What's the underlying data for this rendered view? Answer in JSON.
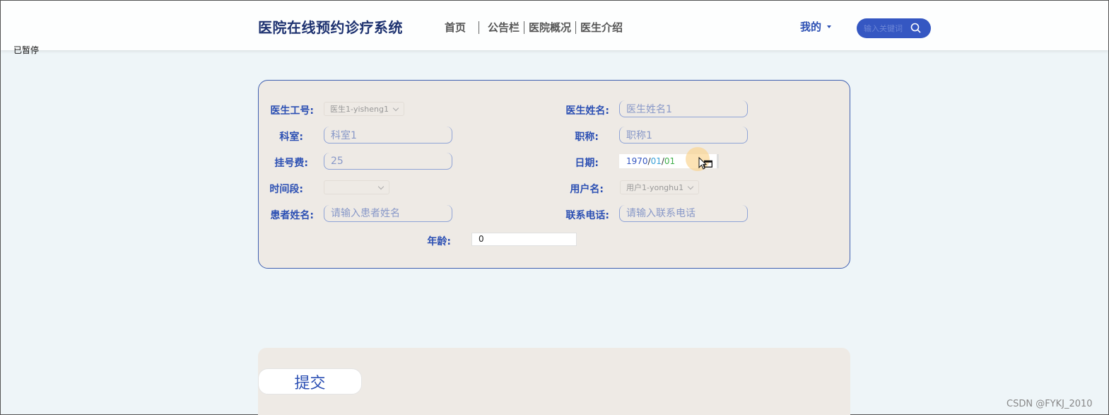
{
  "header": {
    "brand": "医院在线预约诊疗系统",
    "nav": [
      "首页",
      "公告栏",
      "医院概况",
      "医生介绍"
    ],
    "mine_label": "我的",
    "search_placeholder": "输入关键词"
  },
  "overlay": {
    "paused_text": "已暂停"
  },
  "form": {
    "doctor_id": {
      "label": "医生工号:",
      "value": "医生1-yisheng1"
    },
    "doctor_name": {
      "label": "医生姓名:",
      "value": "医生姓名1"
    },
    "department": {
      "label": "科室:",
      "value": "科室1"
    },
    "title": {
      "label": "职称:",
      "value": "职称1"
    },
    "fee": {
      "label": "挂号费:",
      "value": "25"
    },
    "date": {
      "label": "日期:",
      "year": "1970",
      "month": "01",
      "day": "01",
      "sep": "/"
    },
    "time_slot": {
      "label": "时间段:",
      "value": ""
    },
    "username": {
      "label": "用户名:",
      "value": "用户1-yonghu1"
    },
    "patient_name": {
      "label": "患者姓名:",
      "placeholder": "请输入患者姓名"
    },
    "phone": {
      "label": "联系电话:",
      "placeholder": "请输入联系电话"
    },
    "age": {
      "label": "年龄:",
      "value": "0"
    }
  },
  "actions": {
    "submit_label": "提交"
  },
  "footer": {
    "watermark": "CSDN @FYKJ_2010"
  },
  "colors": {
    "accent": "#2b4fb3",
    "brand": "#1e3270",
    "search_bg": "#3557c2",
    "card_bg": "#eeeae5"
  },
  "icons": {
    "search": "search-icon",
    "calendar": "calendar-icon",
    "cursor": "mouse-pointer-icon"
  }
}
